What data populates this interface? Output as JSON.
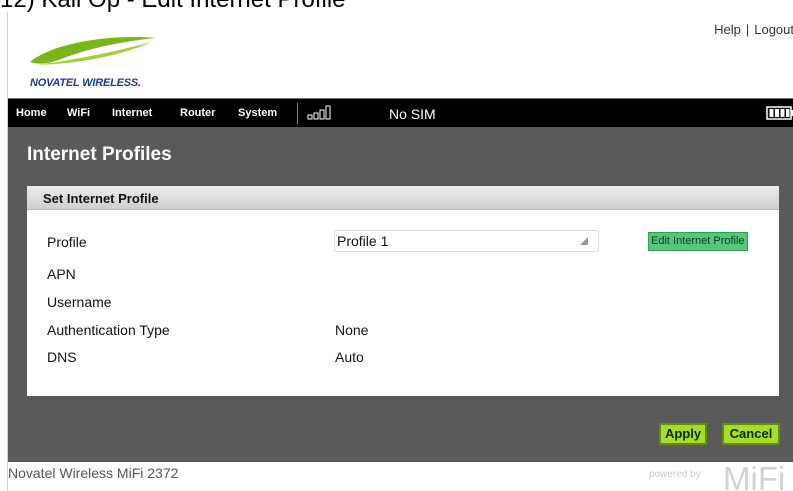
{
  "doc_heading": "12) Kali Op - Edit Internet Profile",
  "header": {
    "logo_text": "NOVATEL WIRELESS.",
    "help_link": "Help",
    "separator": "|",
    "logout_link": "Logout"
  },
  "nav": {
    "items": [
      "Home",
      "WiFi",
      "Internet",
      "Router",
      "System"
    ],
    "sim_status": "No SIM"
  },
  "page_title": "Internet Profiles",
  "panel": {
    "title": "Set Internet Profile",
    "rows": [
      {
        "label": "Profile",
        "value": "Profile 1"
      },
      {
        "label": "APN",
        "value": ""
      },
      {
        "label": "Username",
        "value": ""
      },
      {
        "label": "Authentication Type",
        "value": "None"
      },
      {
        "label": "DNS",
        "value": "Auto"
      }
    ],
    "edit_button": "Edit Internet Profile"
  },
  "buttons": {
    "apply": "Apply",
    "cancel": "Cancel"
  },
  "footer": {
    "device_name": "Novatel Wireless MiFi 2372",
    "powered_by": "powered by",
    "brand": "MiFi"
  },
  "icons": {
    "signal": "signal-strength-icon",
    "battery": "battery-icon",
    "dropdown": "dropdown-arrow-icon"
  },
  "colors": {
    "nav_bg": "#000000",
    "content_bg": "#5a5a5a",
    "edit_button_bg": "#58c77e",
    "action_button_bg": "#a8dc2a",
    "logo_swoosh": "#7ab51d",
    "logo_text": "#1a3d8f"
  }
}
